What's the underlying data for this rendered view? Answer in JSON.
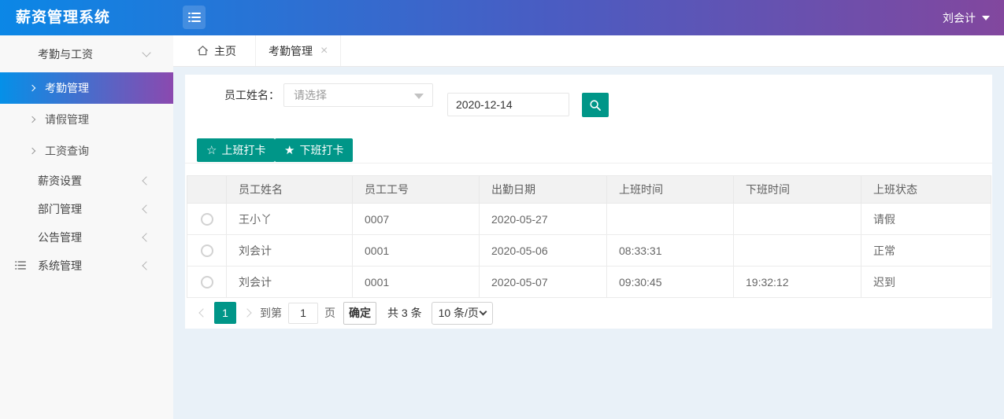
{
  "app": {
    "title": "薪资管理系统",
    "user": "刘会计"
  },
  "colors": {
    "teal": "#009688",
    "header_gradient_start": "#0b87e6",
    "header_gradient_end": "#82479e",
    "active_item_gradient_start": "#0590e8",
    "active_item_gradient_end": "#8b49af",
    "content_background": "#e9f1f8"
  },
  "icons": {
    "burger": "list-icon",
    "star_outline": "☆",
    "star_filled": "★",
    "tab_close": "×",
    "home": "home-icon",
    "search": "magnifier-icon"
  },
  "sidebar": {
    "group_label": "考勤与工资",
    "sub_items": [
      {
        "label": "考勤管理",
        "active": true
      },
      {
        "label": "请假管理",
        "active": false
      },
      {
        "label": "工资查询",
        "active": false
      }
    ],
    "top_items": [
      {
        "label": "薪资设置",
        "icon": ""
      },
      {
        "label": "部门管理",
        "icon": ""
      },
      {
        "label": "公告管理",
        "icon": ""
      },
      {
        "label": "系统管理",
        "icon": "list-icon"
      }
    ]
  },
  "tabs": {
    "home_label": "主页",
    "active_tab_label": "考勤管理"
  },
  "filter": {
    "name_label": "员工姓名：",
    "select_placeholder": "请选择",
    "date_value": "2020-12-14"
  },
  "actions": {
    "clock_in_label": "上班打卡",
    "clock_out_label": "下班打卡"
  },
  "table": {
    "columns": [
      "员工姓名",
      "员工工号",
      "出勤日期",
      "上班时间",
      "下班时间",
      "上班状态"
    ],
    "rows": [
      [
        "王小丫",
        "0007",
        "2020-05-27",
        "",
        "",
        "请假"
      ],
      [
        "刘会计",
        "0001",
        "2020-05-06",
        "08:33:31",
        "",
        "正常"
      ],
      [
        "刘会计",
        "0001",
        "2020-05-07",
        "09:30:45",
        "19:32:12",
        "迟到"
      ]
    ]
  },
  "pagination": {
    "current_page": "1",
    "goto_prefix": "到第",
    "goto_value": "1",
    "goto_suffix": "页",
    "confirm_label": "确定",
    "total_label": "共 3 条",
    "page_size_label": "10 条/页"
  }
}
